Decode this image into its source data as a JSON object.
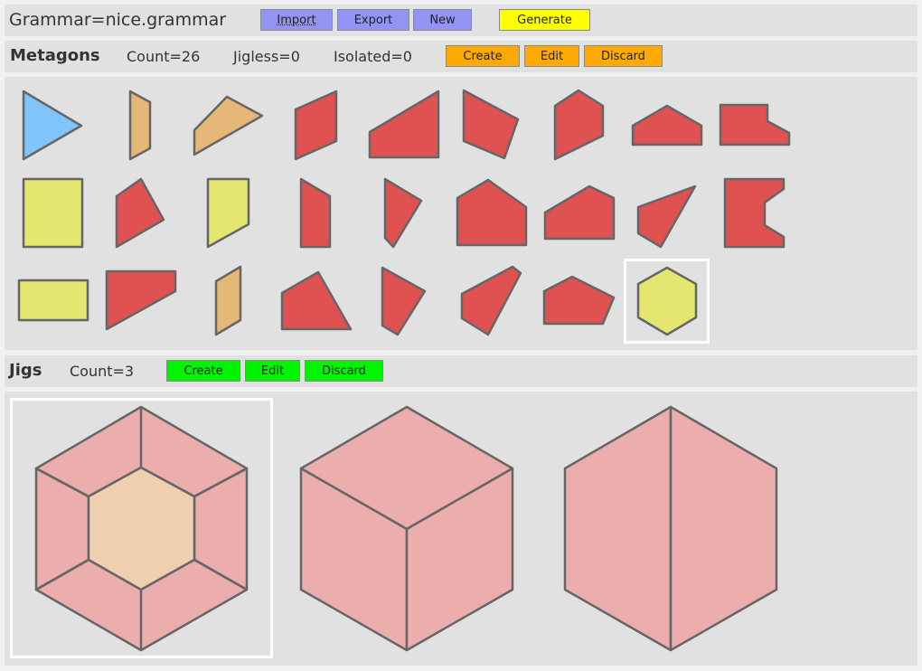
{
  "grammar_bar": {
    "title": "Grammar=nice.grammar",
    "buttons": [
      "Import",
      "Export",
      "New"
    ],
    "generate_label": "Generate"
  },
  "metagons_bar": {
    "heading": "Metagons",
    "count": "Count=26",
    "jigless": "Jigless=0",
    "isolated": "Isolated=0",
    "create_label": "Create",
    "edit_label": "Edit",
    "discard_label": "Discard"
  },
  "jigs_bar": {
    "heading": "Jigs",
    "count": "Count=3",
    "create_label": "Create",
    "edit_label": "Edit",
    "discard_label": "Discard"
  },
  "colors": {
    "blue": "#7fc4fa",
    "tan": "#e6b877",
    "red": "#e05152",
    "yellow": "#e5e66f",
    "jig_pink": "#ecadad",
    "jig_peach": "#efcfaf"
  },
  "metagon_colors": [
    "blue",
    "tan",
    "tan",
    "red",
    "red",
    "red",
    "red",
    "red",
    "red",
    "yellow",
    "red",
    "yellow",
    "red",
    "red",
    "red",
    "red",
    "red",
    "red",
    "yellow",
    "red",
    "tan",
    "red",
    "red",
    "red",
    "red",
    "yellow"
  ],
  "selected_metagon_index": 25,
  "selected_jig_index": 0
}
